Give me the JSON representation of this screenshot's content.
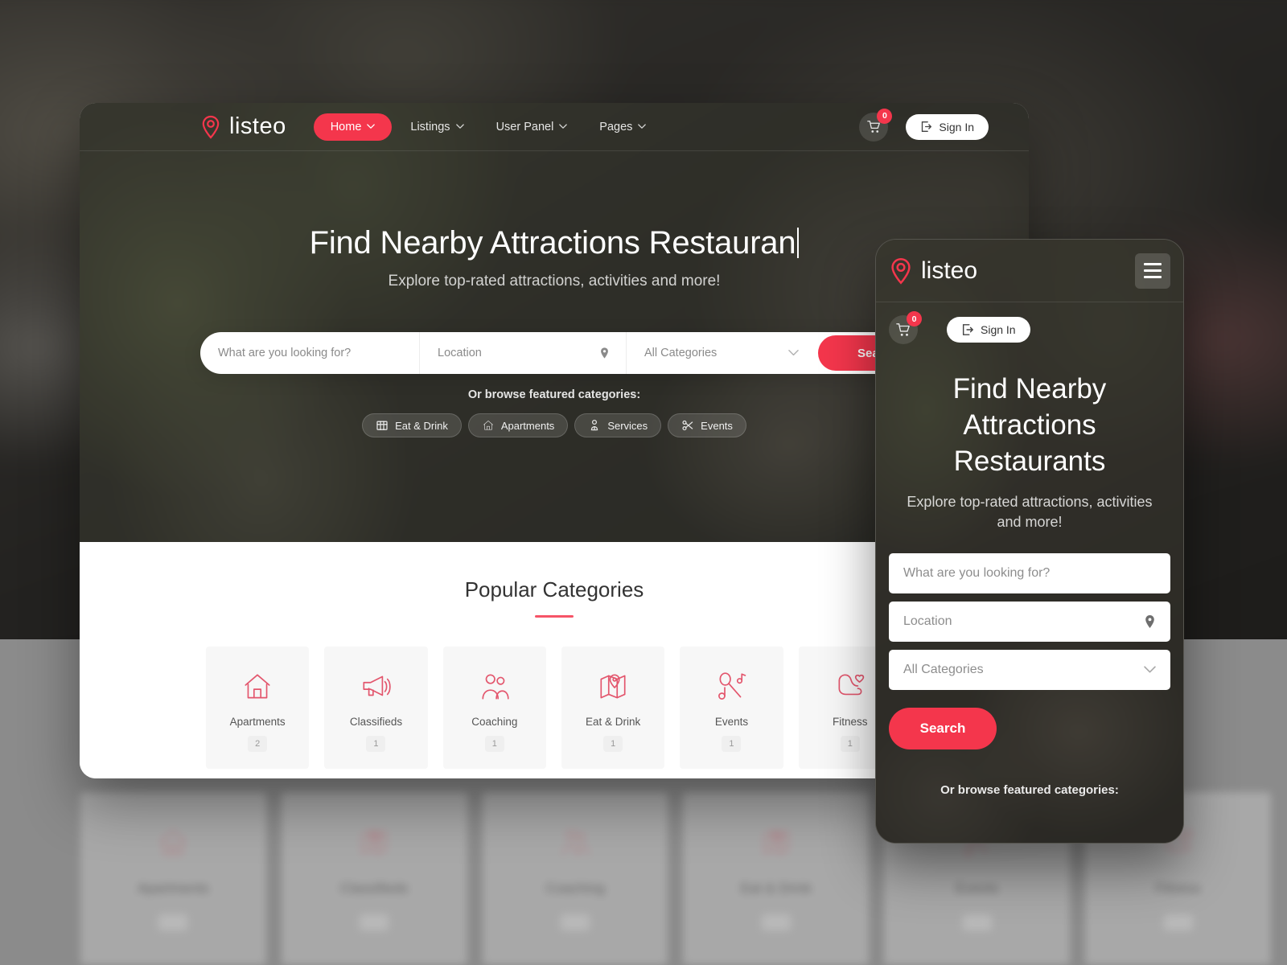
{
  "brand": {
    "name": "listeo",
    "accent": "#f4364c"
  },
  "desktop": {
    "nav": [
      {
        "label": "Home",
        "active": true
      },
      {
        "label": "Listings",
        "active": false
      },
      {
        "label": "User Panel",
        "active": false
      },
      {
        "label": "Pages",
        "active": false
      }
    ],
    "cart_count": "0",
    "signin_label": "Sign In",
    "hero": {
      "heading": "Find Nearby Attractions Restauran",
      "subheading": "Explore top-rated attractions, activities and more!"
    },
    "search": {
      "keyword_placeholder": "What are you looking for?",
      "location_placeholder": "Location",
      "category_value": "All Categories",
      "button_label": "Search"
    },
    "featured": {
      "label": "Or browse featured categories:",
      "pills": [
        {
          "label": "Eat & Drink",
          "icon": "restaurant-icon"
        },
        {
          "label": "Apartments",
          "icon": "home-icon"
        },
        {
          "label": "Services",
          "icon": "service-icon"
        },
        {
          "label": "Events",
          "icon": "events-icon"
        }
      ]
    },
    "popular": {
      "title": "Popular Categories",
      "cards": [
        {
          "label": "Apartments",
          "count": "2",
          "icon": "home-icon"
        },
        {
          "label": "Classifieds",
          "count": "1",
          "icon": "megaphone-icon"
        },
        {
          "label": "Coaching",
          "count": "1",
          "icon": "coaching-icon"
        },
        {
          "label": "Eat & Drink",
          "count": "1",
          "icon": "map-pin-icon"
        },
        {
          "label": "Events",
          "count": "1",
          "icon": "microphone-icon"
        },
        {
          "label": "Fitness",
          "count": "1",
          "icon": "fitness-icon"
        }
      ]
    }
  },
  "mobile": {
    "cart_count": "0",
    "signin_label": "Sign In",
    "hero": {
      "heading_line1": "Find Nearby",
      "heading_line2": "Attractions",
      "heading_line3": "Restaurants",
      "subheading": "Explore top-rated attractions, activities and more!"
    },
    "search": {
      "keyword_placeholder": "What are you looking for?",
      "location_placeholder": "Location",
      "category_value": "All Categories",
      "button_label": "Search"
    },
    "featured_label": "Or browse featured categories:"
  },
  "background": {
    "cards": [
      {
        "label": "Apartments",
        "count": "4",
        "icon": "home-icon"
      },
      {
        "label": "Classifieds",
        "count": "1",
        "icon": "map-pin-icon"
      },
      {
        "label": "Coaching",
        "count": "1",
        "icon": "coaching-icon"
      },
      {
        "label": "Eat & Drink",
        "count": "1",
        "icon": "map-pin-icon"
      },
      {
        "label": "Events",
        "count": "1",
        "icon": "microphone-icon"
      },
      {
        "label": "Fitness",
        "count": "1",
        "icon": "fitness-icon"
      }
    ]
  }
}
